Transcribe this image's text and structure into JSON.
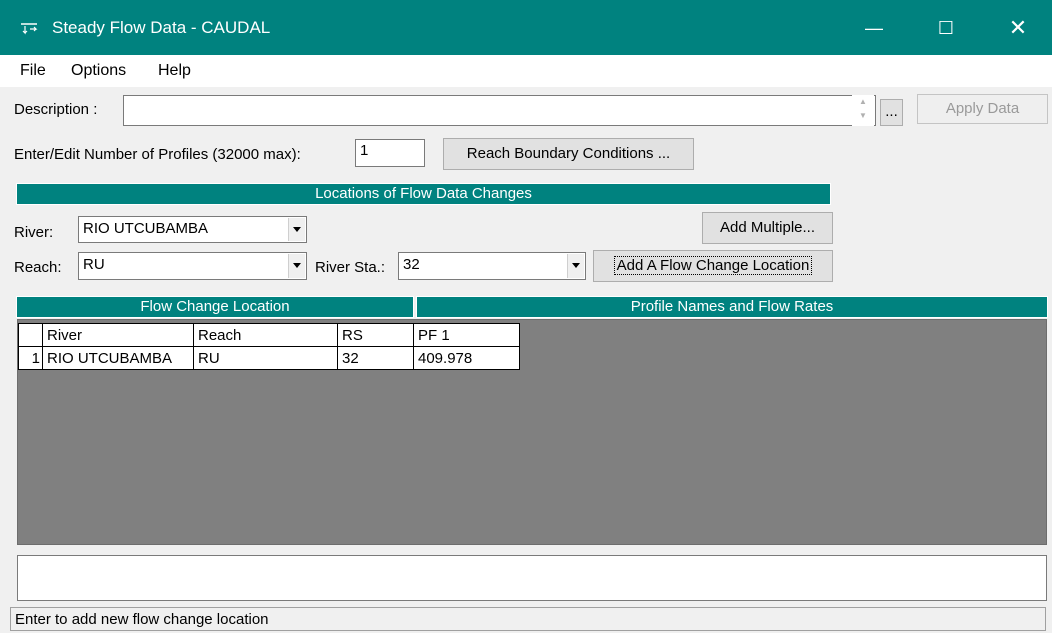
{
  "window": {
    "title": "Steady Flow Data - CAUDAL",
    "minimize": "—",
    "maximize": "☐",
    "close": "✕"
  },
  "menu": {
    "file": "File",
    "options": "Options",
    "help": "Help"
  },
  "description": {
    "label": "Description :",
    "value": "",
    "browse_label": "...",
    "apply_label": "Apply Data"
  },
  "profiles": {
    "label": "Enter/Edit Number of Profiles (32000 max):",
    "value": "1",
    "boundary_button": "Reach Boundary Conditions ..."
  },
  "locations": {
    "header": "Locations of Flow Data Changes",
    "river_label": "River:",
    "river_value": "RIO UTCUBAMBA",
    "reach_label": "Reach:",
    "reach_value": "RU",
    "station_label": "River Sta.:",
    "station_value": "32",
    "add_multiple": "Add Multiple...",
    "add_location": "Add A Flow Change Location"
  },
  "grid": {
    "left_header": "Flow Change Location",
    "right_header": "Profile Names and Flow Rates",
    "columns": [
      "River",
      "Reach",
      "RS",
      "PF 1"
    ],
    "rows": [
      {
        "num": "1",
        "river": "RIO UTCUBAMBA",
        "reach": "RU",
        "rs": "32",
        "pf1": "409.978"
      }
    ]
  },
  "status": {
    "text": "Enter to add new flow change location"
  },
  "colors": {
    "accent": "#00827f",
    "grid_background": "#808080"
  }
}
